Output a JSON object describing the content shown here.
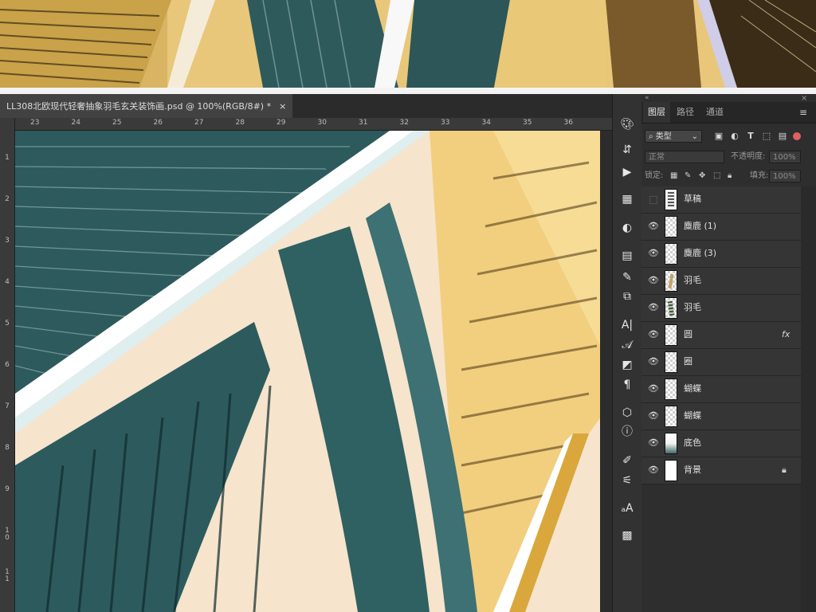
{
  "document_tab": {
    "title": "LL308北欧现代轻奢抽象羽毛玄关装饰画.psd @ 100%(RGB/8#) *",
    "close_glyph": "×"
  },
  "ruler": {
    "top_ticks": [
      "23",
      "24",
      "25",
      "26",
      "27",
      "28",
      "29",
      "30",
      "31",
      "32",
      "33",
      "34",
      "35",
      "36"
    ],
    "left_ticks": [
      "1",
      "2",
      "3",
      "4",
      "5",
      "6",
      "7",
      "8",
      "9",
      "10",
      "11"
    ]
  },
  "panel": {
    "tabs": [
      "图层",
      "路径",
      "通道"
    ],
    "collapse_glyph": "«",
    "close_glyph": "×",
    "menu_glyph": "≡",
    "filter": {
      "kind_label": "类型"
    },
    "blend_mode": "正常",
    "opacity_label": "不透明度:",
    "opacity_value": "100%",
    "lock_label": "锁定:",
    "fill_label": "填充:",
    "fill_value": "100%"
  },
  "layers": [
    {
      "name": "草稿",
      "visible": false,
      "thumb": "sketch",
      "fx": false,
      "locked": false
    },
    {
      "name": "麋鹿 (1)",
      "visible": true,
      "thumb": "transparent",
      "fx": false,
      "locked": false
    },
    {
      "name": "麋鹿 (3)",
      "visible": true,
      "thumb": "transparent",
      "fx": false,
      "locked": false
    },
    {
      "name": "羽毛",
      "visible": true,
      "thumb": "feather",
      "fx": false,
      "locked": false
    },
    {
      "name": "羽毛",
      "visible": true,
      "thumb": "feather-dark",
      "fx": false,
      "locked": false
    },
    {
      "name": "圆",
      "visible": true,
      "thumb": "transparent",
      "fx": true,
      "locked": false
    },
    {
      "name": "圈",
      "visible": true,
      "thumb": "transparent",
      "fx": false,
      "locked": false
    },
    {
      "name": "蝴蝶",
      "visible": true,
      "thumb": "transparent",
      "fx": false,
      "locked": false
    },
    {
      "name": "蝴蝶",
      "visible": true,
      "thumb": "transparent",
      "fx": false,
      "locked": false
    },
    {
      "name": "底色",
      "visible": true,
      "thumb": "gradient",
      "fx": false,
      "locked": false
    },
    {
      "name": "背景",
      "visible": true,
      "thumb": "white",
      "fx": false,
      "locked": true
    }
  ],
  "fx_label": "fx",
  "tools": [
    "palette-icon",
    "layer-comps-icon",
    "play-icon",
    "grid-icon",
    "adjustments-icon",
    "properties-icon",
    "notes-icon",
    "history-icon",
    "character-icon",
    "glyphs-icon",
    "styles-icon",
    "paragraph-icon",
    "3d-icon",
    "info-icon",
    "brush-settings-icon",
    "brushes-icon",
    "char-styles-icon",
    "swatches-icon"
  ],
  "colors": {
    "teal": "#2e5d5f",
    "gold": "#e3bd5e",
    "cream": "#f6e4cc"
  }
}
